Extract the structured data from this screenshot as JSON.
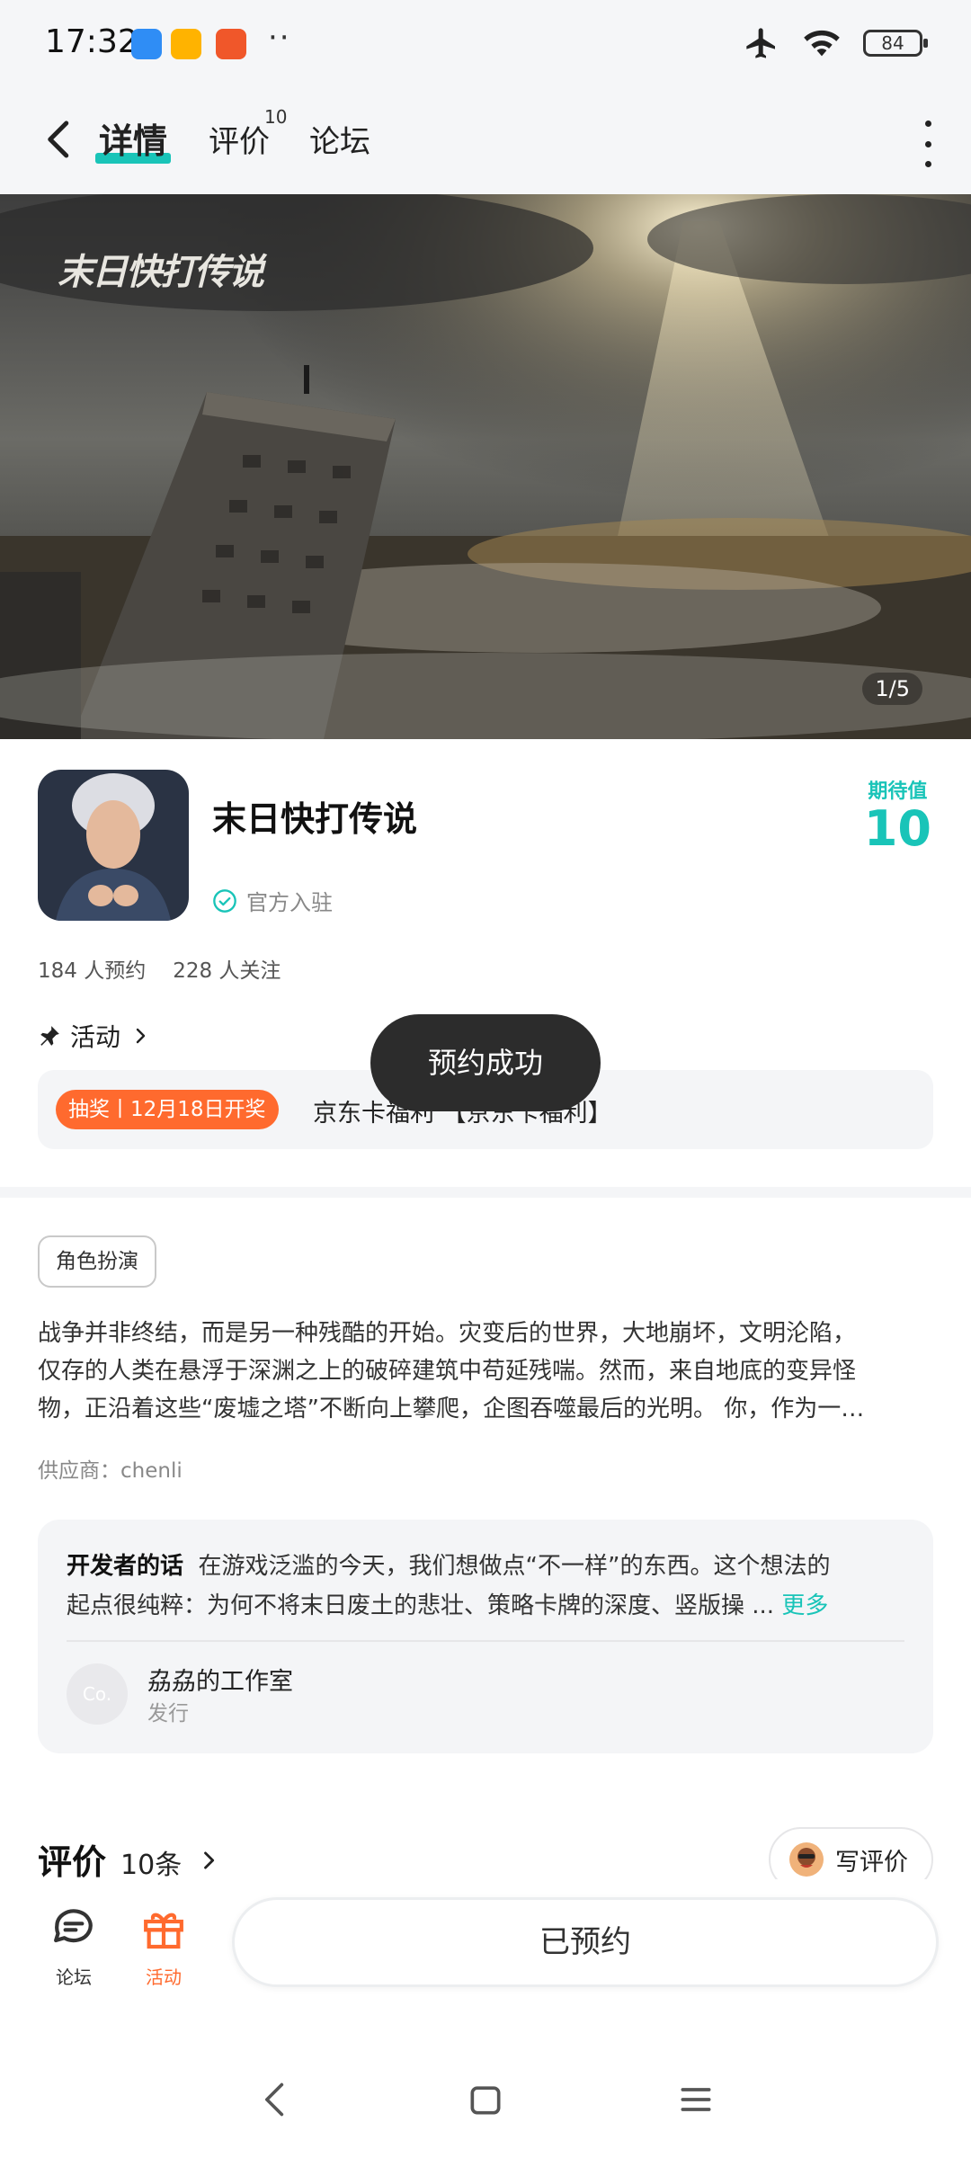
{
  "status_bar": {
    "time": "17:32",
    "battery": "84"
  },
  "nav": {
    "tabs": [
      {
        "label": "详情"
      },
      {
        "label": "评价",
        "badge": "10"
      },
      {
        "label": "论坛"
      }
    ]
  },
  "hero": {
    "counter": "1/5",
    "logo_text": "末日快打传说"
  },
  "game": {
    "title": "末日快打传说",
    "official_label": "官方入驻",
    "expectation_label": "期待值",
    "expectation_value": "10",
    "reservations": "184 人预约",
    "followers": "228 人关注"
  },
  "activity": {
    "header": "活动",
    "tag": "抽奖丨12月18日开奖",
    "text": "京东卡福利 【京东卡福利】"
  },
  "toast": "预约成功",
  "genre": "角色扮演",
  "description": {
    "line1": "战争并非终结，而是另一种残酷的开始。灾变后的世界，大地崩坏，文明沦陷，",
    "line2": "仅存的人类在悬浮于深渊之上的破碎建筑中苟延残喘。然而，来自地底的变异怪",
    "line3": "物，正沿着这些“废墟之塔”不断向上攀爬，企图吞噬最后的光明。 你，作为一…"
  },
  "supplier": "供应商：chenli",
  "developer": {
    "label": "开发者的话",
    "text1": "在游戏泛滥的今天，我们想做点“不一样”的东西。这个想法的",
    "text2": "起点很纯粹：为何不将末日废土的悲壮、策略卡牌的深度、竖版操 ...",
    "more": "更多",
    "avatar_text": "Co.",
    "studio": "劦劦的工作室",
    "role": "发行"
  },
  "reviews": {
    "title": "评价",
    "count": "10条",
    "write_label": "写评价"
  },
  "bottom_bar": {
    "forum_label": "论坛",
    "activity_label": "活动",
    "reserve_button": "已预约"
  },
  "colors": {
    "accent": "#19c4b8",
    "orange": "#ff6a2e"
  }
}
